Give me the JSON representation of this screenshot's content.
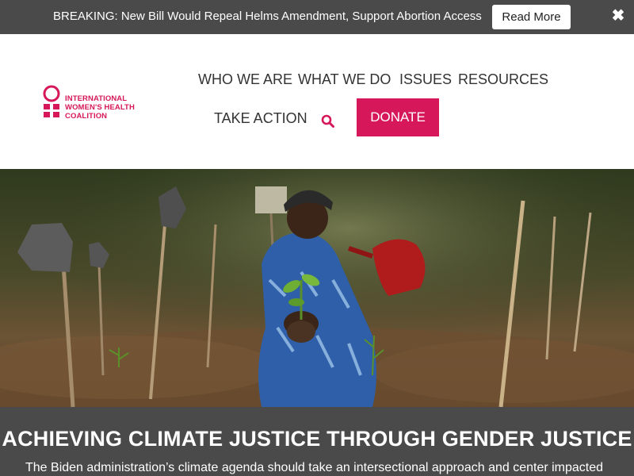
{
  "alert": {
    "text": "BREAKING: New Bill Would Repeal Helms Amendment, Support Abortion Access",
    "button_label": "Read More",
    "close_glyph": "✖"
  },
  "logo": {
    "line1": "INTERNATIONAL",
    "line2": "WOMEN'S HEALTH",
    "line3": "COALITION",
    "color": "#d6185a"
  },
  "nav": {
    "who_we_are": "WHO WE ARE",
    "what_we_do": "WHAT WE DO",
    "issues": "ISSUES",
    "resources": "RESOURCES",
    "take_action": "TAKE ACTION",
    "search_icon": "search-icon",
    "donate": "DONATE"
  },
  "hero": {
    "image_alt": "Woman kneeling holding a seedling in a forest clearing"
  },
  "feature": {
    "title": "ACHIEVING CLIMATE JUSTICE THROUGH GENDER JUSTICE",
    "description": "The Biden administration’s climate agenda should take an intersectional approach and center impacted"
  },
  "colors": {
    "brand": "#d6185a",
    "bar_bg": "#4a4a4a",
    "nav_text": "#333333"
  }
}
